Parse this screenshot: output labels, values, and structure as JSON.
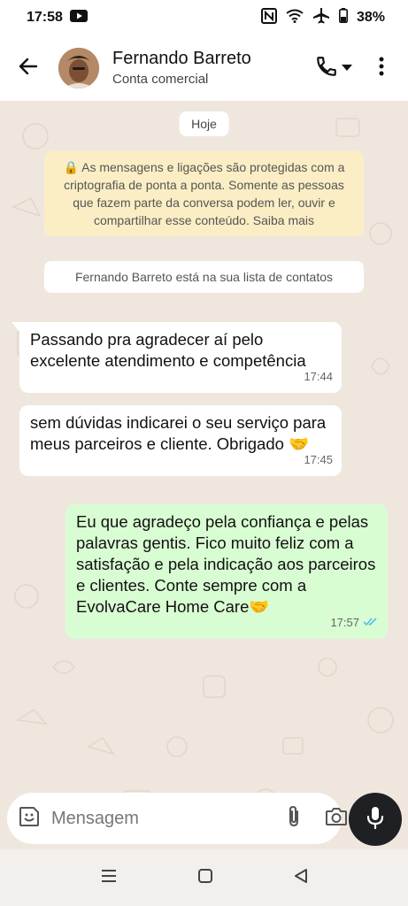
{
  "status_bar": {
    "time": "17:58",
    "battery": "38%"
  },
  "header": {
    "contact_name": "Fernando Barreto",
    "contact_subtitle": "Conta comercial"
  },
  "chat": {
    "date_chip": "Hoje",
    "encryption_note": "🔒 As mensagens e ligações são protegidas com a criptografia de ponta a ponta. Somente as pessoas que fazem parte da conversa podem ler, ouvir e compartilhar esse conteúdo. Saiba mais",
    "contact_note": "Fernando Barreto está na sua lista de contatos",
    "messages": [
      {
        "direction": "incoming",
        "text": "Passando pra agradecer aí pelo excelente atendimento e competência",
        "time": "17:44"
      },
      {
        "direction": "incoming",
        "text": "sem dúvidas indicarei o seu serviço para meus parceiros e cliente. Obrigado 🤝",
        "time": "17:45"
      },
      {
        "direction": "outgoing",
        "text": "Eu que agradeço pela confiança e pelas palavras gentis. Fico muito feliz com a satisfação e pela indicação aos parceiros e clientes. Conte sempre com a EvolvaCare Home Care🤝",
        "time": "17:57",
        "status": "read"
      }
    ]
  },
  "composer": {
    "placeholder": "Mensagem"
  },
  "colors": {
    "incoming_bubble": "#ffffff",
    "outgoing_bubble": "#d9fdd3",
    "chat_background": "#efe7de",
    "read_ticks": "#53bdeb",
    "mic_button": "#1f2024"
  },
  "icons": {
    "back": "arrow-left-icon",
    "call": "phone-icon",
    "menu": "more-vertical-icon",
    "emoji": "sticker-icon",
    "attach": "paperclip-icon",
    "camera": "camera-icon",
    "mic": "microphone-icon"
  }
}
